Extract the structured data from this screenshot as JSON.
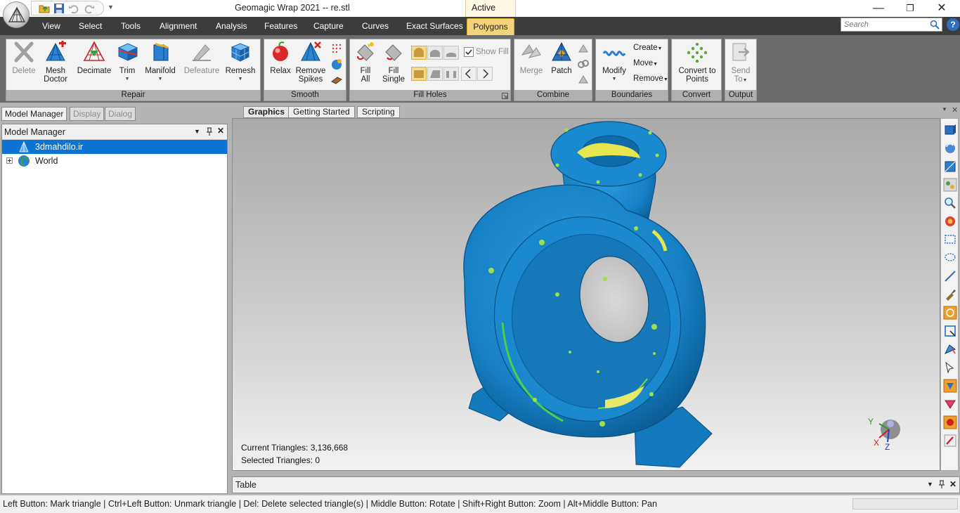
{
  "window": {
    "title": "Geomagic Wrap 2021 -- re.stl",
    "context_tab": "Active",
    "controls": {
      "minimize": "—",
      "restore": "❐",
      "close": "✕"
    }
  },
  "menu": {
    "tabs": [
      "View",
      "Select",
      "Tools",
      "Alignment",
      "Analysis",
      "Features",
      "Capture",
      "Curves",
      "Exact Surfaces",
      "Polygons"
    ],
    "active": "Polygons"
  },
  "search": {
    "placeholder": "Search"
  },
  "ribbon": {
    "repair": {
      "label": "Repair",
      "delete_l1": "Delete",
      "mesh_doctor_l1": "Mesh",
      "mesh_doctor_l2": "Doctor",
      "decimate_l1": "Decimate",
      "trim_l1": "Trim",
      "manifold_l1": "Manifold",
      "defeature_l1": "Defeature",
      "remesh_l1": "Remesh"
    },
    "smooth": {
      "label": "Smooth",
      "relax_l1": "Relax",
      "remove_spikes_l1": "Remove",
      "remove_spikes_l2": "Spikes"
    },
    "fill_holes": {
      "label": "Fill Holes",
      "fill_all_l1": "Fill",
      "fill_all_l2": "All",
      "fill_single_l1": "Fill",
      "fill_single_l2": "Single",
      "show_fill": "Show Fill"
    },
    "combine": {
      "label": "Combine",
      "merge_l1": "Merge",
      "patch_l1": "Patch"
    },
    "boundaries": {
      "label": "Boundaries",
      "modify_l1": "Modify",
      "create": "Create",
      "move": "Move",
      "remove": "Remove"
    },
    "convert": {
      "label": "Convert",
      "convert_l1": "Convert to",
      "convert_l2": "Points"
    },
    "output": {
      "label": "Output",
      "send_l1": "Send",
      "send_l2": "To"
    }
  },
  "panels": {
    "tabs": [
      "Model Manager",
      "Display",
      "Dialog"
    ],
    "model_manager": {
      "title": "Model Manager",
      "items": [
        {
          "label": "3dmahdilo.ir",
          "selected": true
        },
        {
          "label": "World",
          "selected": false
        }
      ]
    }
  },
  "viewport": {
    "tabs": [
      "Graphics",
      "Getting Started",
      "Scripting"
    ],
    "active_tab": "Graphics",
    "current_triangles": "Current Triangles: 3,136,668",
    "selected_triangles": "Selected Triangles: 0",
    "triad": {
      "x": "X",
      "y": "Y",
      "z": "Z"
    }
  },
  "table_panel": {
    "title": "Table"
  },
  "status": {
    "text": "Left Button: Mark triangle | Ctrl+Left Button: Unmark triangle | Del: Delete selected triangle(s) | Middle Button: Rotate | Shift+Right Button: Zoom | Alt+Middle Button: Pan"
  },
  "colors": {
    "accent": "#f2d27a",
    "model": "#1a86c8",
    "selection": "#0a73d4",
    "menubar": "#3c3c3c"
  }
}
